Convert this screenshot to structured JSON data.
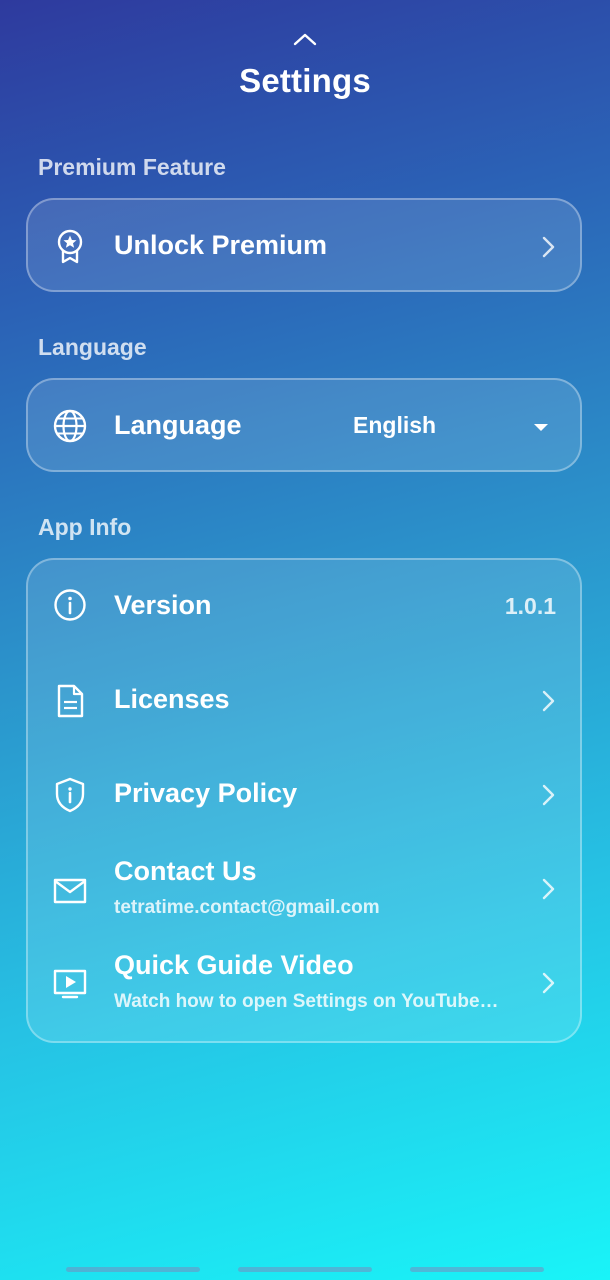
{
  "header": {
    "title": "Settings"
  },
  "sections": {
    "premium": {
      "label": "Premium Feature",
      "unlock_label": "Unlock Premium"
    },
    "language": {
      "label": "Language",
      "row_label": "Language",
      "selected": "English"
    },
    "app_info": {
      "label": "App Info",
      "version_label": "Version",
      "version_value": "1.0.1",
      "licenses_label": "Licenses",
      "privacy_label": "Privacy Policy",
      "contact_label": "Contact Us",
      "contact_email": "tetratime.contact@gmail.com",
      "guide_label": "Quick Guide Video",
      "guide_subtitle": "Watch how to open Settings on YouTube…"
    }
  },
  "icons": {
    "collapse": "chevron-up-icon",
    "premium": "award-badge-icon",
    "language": "globe-icon",
    "version": "info-icon",
    "licenses": "document-icon",
    "privacy": "shield-info-icon",
    "contact": "mail-icon",
    "guide": "video-play-icon",
    "chevron": "chevron-right-icon",
    "dropdown": "caret-down-icon"
  },
  "colors": {
    "gradient_top": "#2e3a9e",
    "gradient_bottom": "#19f4f8",
    "text": "#ffffff"
  }
}
